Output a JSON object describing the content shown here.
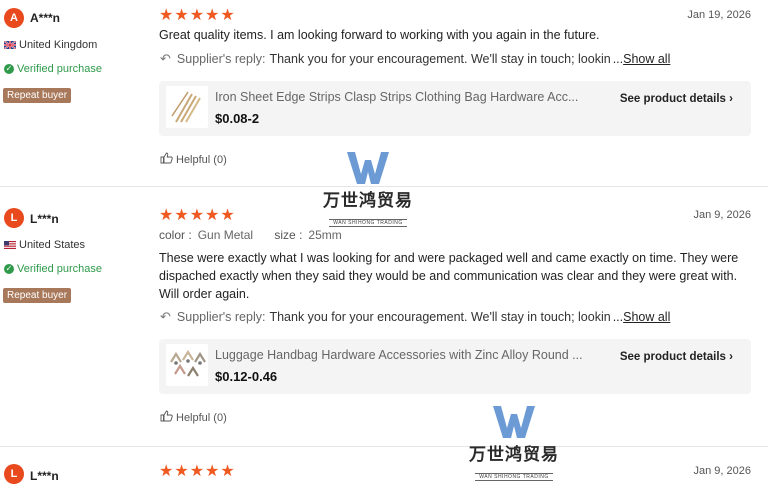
{
  "reviews": [
    {
      "initial": "A",
      "name": "A***n",
      "country": "United Kingdom",
      "verified": "Verified purchase",
      "badge": "Repeat buyer",
      "stars": "★★★★★",
      "date": "Jan 19, 2026",
      "text": "Great quality items. I am looking forward to working with you again in the future.",
      "reply_label": "Supplier's reply:",
      "reply_text": "Thank you for your encouragement. We'll stay in touch; lookin",
      "show_all": "Show all",
      "product_title": "Iron Sheet Edge Strips Clasp Strips Clothing Bag Hardware Acc...",
      "product_price": "$0.08-2",
      "product_link": "See product details",
      "helpful": "Helpful (0)"
    },
    {
      "initial": "L",
      "name": "L***n",
      "country": "United States",
      "verified": "Verified purchase",
      "badge": "Repeat buyer",
      "stars": "★★★★★",
      "date": "Jan 9, 2026",
      "color_label": "color :",
      "color_value": "Gun Metal",
      "size_label": "size :",
      "size_value": "25mm",
      "text": "These were exactly what I was looking for and were packaged well and came exactly on time.  They were dispached exactly when they said they would be and communication was clear and they were great with. Will order again.",
      "reply_label": "Supplier's reply:",
      "reply_text": "Thank you for your encouragement. We'll stay in touch; lookin",
      "show_all": "Show all",
      "product_title": "Luggage Handbag Hardware Accessories with Zinc Alloy Round ...",
      "product_price": "$0.12-0.46",
      "product_link": "See product details",
      "helpful": "Helpful (0)"
    },
    {
      "initial": "L",
      "name": "L***n",
      "stars": "★★★★★",
      "date": "Jan 9, 2026"
    }
  ],
  "watermark": {
    "cn": "万世鸿贸易",
    "en": "WAN SHIHONG TRADING"
  },
  "colors": {
    "star": "#f05a22",
    "verified": "#2f9a4a",
    "badge": "#a8785a",
    "avatar": "#e8491d"
  }
}
